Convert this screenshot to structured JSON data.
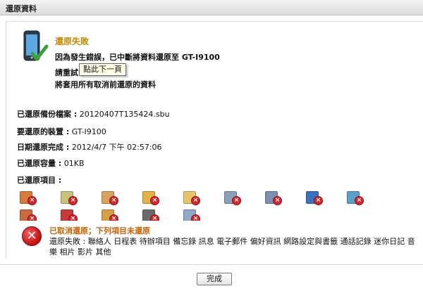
{
  "window": {
    "title": "還原資料"
  },
  "status": {
    "title": "還原失敗",
    "message_line1": "因為發生錯誤，已中斷將資料還原至 GT-I9100",
    "message_line2": "請重試",
    "message_line3": "將套用所有取消前還原的資料"
  },
  "tooltip": {
    "text": "點此下一頁"
  },
  "info": {
    "backup_file_label": "已還原備份檔案 :",
    "backup_file_value": " 20120407T135424.sbu",
    "device_label": "要還原的裝置 :",
    "device_value": " GT-I9100",
    "date_label": "日期還原完成 :",
    "date_value": " 2012/4/7 下午 02:57:06",
    "size_label": "已還原容量 :",
    "size_value": " 01KB",
    "items_label": "已還原項目 :"
  },
  "categories_row1": [
    {
      "icon": "contacts-icon",
      "color": "#d87a3a"
    },
    {
      "icon": "calendar-icon",
      "color": "#c9c27a"
    },
    {
      "icon": "tasks-icon",
      "color": "#d9a15a"
    },
    {
      "icon": "memo-icon",
      "color": "#e3b245"
    },
    {
      "icon": "message-icon",
      "color": "#e9c56a"
    },
    {
      "icon": "email-icon",
      "color": "#8aa0b8"
    },
    {
      "icon": "preferences-icon",
      "color": "#7c8fb0"
    },
    {
      "icon": "network-icon",
      "color": "#3a72c0"
    },
    {
      "icon": "call-log-icon",
      "color": "#5aa0c8"
    }
  ],
  "categories_row2": [
    {
      "icon": "diary-icon",
      "color": "#c86a3a"
    },
    {
      "icon": "music-icon",
      "color": "#c83a3a"
    },
    {
      "icon": "photo-icon",
      "color": "#d4a040"
    },
    {
      "icon": "video-icon",
      "color": "#6a6a6a"
    },
    {
      "icon": "other-icon",
      "color": "#8fa8c8"
    }
  ],
  "error": {
    "title": "已取消還原；下列項目未還原",
    "text": "還原失敗 : 聯絡人 日程表 待辦項目 備忘錄 訊息 電子郵件 偏好資訊 網路設定與書籤 通話記錄 迷你日記 音樂 相片 影片 其他"
  },
  "buttons": {
    "done": "完成"
  }
}
